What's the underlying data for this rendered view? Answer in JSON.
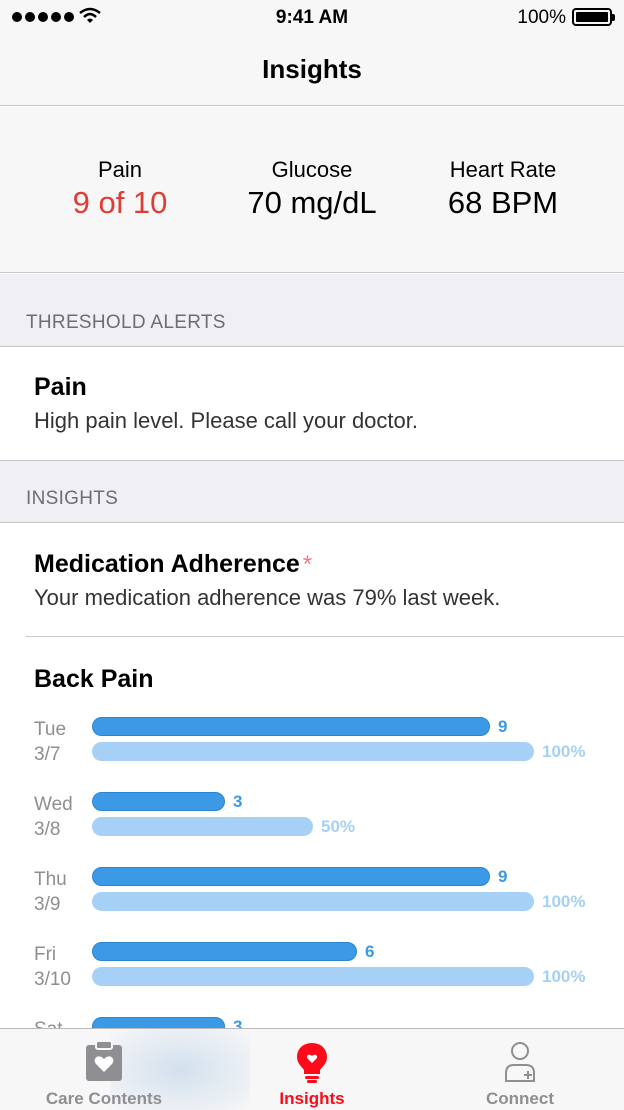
{
  "status_bar": {
    "time": "9:41 AM",
    "battery": "100%"
  },
  "nav": {
    "title": "Insights"
  },
  "vitals": [
    {
      "label": "Pain",
      "value": "9 of 10",
      "color": "#e23b34"
    },
    {
      "label": "Glucose",
      "value": "70 mg/dL"
    },
    {
      "label": "Heart Rate",
      "value": "68 BPM"
    }
  ],
  "sections": {
    "threshold": "THRESHOLD ALERTS",
    "insights": "INSIGHTS"
  },
  "alert": {
    "title": "Pain",
    "text": "High pain level. Please call your doctor."
  },
  "medication": {
    "title": "Medication Adherence",
    "asterisk": "*",
    "text": "Your medication adherence was 79% last week."
  },
  "chart_data": {
    "type": "bar",
    "title": "Back Pain",
    "categories": [
      {
        "day": "Tue",
        "date": "3/7"
      },
      {
        "day": "Wed",
        "date": "3/8"
      },
      {
        "day": "Thu",
        "date": "3/9"
      },
      {
        "day": "Fri",
        "date": "3/10"
      },
      {
        "day": "Sat",
        "date": ""
      }
    ],
    "series": [
      {
        "values": [
          9,
          3,
          9,
          6,
          3
        ],
        "labels": [
          "9",
          "3",
          "9",
          "6",
          "3"
        ],
        "max": 10,
        "color": "#3b99e6"
      },
      {
        "values": [
          100,
          50,
          100,
          100
        ],
        "labels": [
          "100%",
          "50%",
          "100%",
          "100%"
        ],
        "max": 100,
        "color": "#a6d0f5"
      }
    ]
  },
  "tabs": [
    {
      "label": "Care Contents",
      "icon": "clipboard-heart-icon"
    },
    {
      "label": "Insights",
      "icon": "lightbulb-heart-icon",
      "active": true,
      "color": "#ff0a1a"
    },
    {
      "label": "Connect",
      "icon": "person-plus-icon"
    }
  ]
}
